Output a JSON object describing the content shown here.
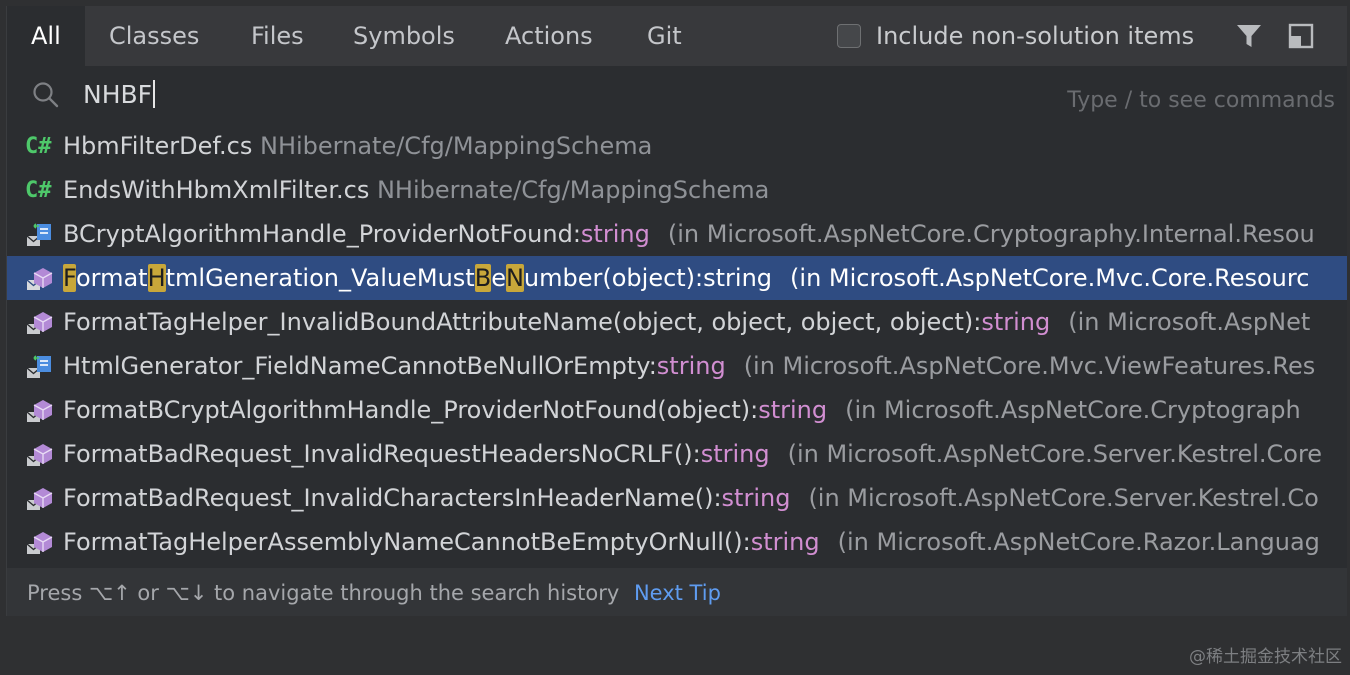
{
  "tabs": [
    "All",
    "Classes",
    "Files",
    "Symbols",
    "Actions",
    "Git"
  ],
  "toolbar": {
    "include_label": "Include non-solution items",
    "filter_icon": "filter-icon",
    "preview_icon": "preview-panel-icon"
  },
  "search": {
    "value": "NHBF",
    "hint": "Type / to see commands"
  },
  "results": [
    {
      "icon": "csharp-file-icon",
      "name": "HbmFilterDef.cs",
      "path": "NHibernate/Cfg/MappingSchema"
    },
    {
      "icon": "csharp-file-icon",
      "name": "EndsWithHbmXmlFilter.cs",
      "path": "NHibernate/Cfg/MappingSchema"
    },
    {
      "icon": "resource-property-icon",
      "name": "BCryptAlgorithmHandle_ProviderNotFound:",
      "type": "string",
      "location": "(in Microsoft.AspNetCore.Cryptography.Internal.Resou"
    },
    {
      "icon": "resource-method-icon",
      "name_parts": [
        "F",
        "ormat",
        "H",
        "tmlGeneration_ValueMust",
        "B",
        "e",
        "N",
        "umber(object):string"
      ],
      "location": "(in Microsoft.AspNetCore.Mvc.Core.Resourc",
      "selected": true
    },
    {
      "icon": "resource-method-icon",
      "name": "FormatTagHelper_InvalidBoundAttributeName(object, object, object, object):",
      "type": "string",
      "location": "(in Microsoft.AspNet"
    },
    {
      "icon": "resource-property-icon",
      "name": "HtmlGenerator_FieldNameCannotBeNullOrEmpty:",
      "type": "string",
      "location": "(in Microsoft.AspNetCore.Mvc.ViewFeatures.Res"
    },
    {
      "icon": "resource-method-icon",
      "name": "FormatBCryptAlgorithmHandle_ProviderNotFound(object):",
      "type": "string",
      "location": "(in Microsoft.AspNetCore.Cryptograph"
    },
    {
      "icon": "resource-method-icon",
      "name": "FormatBadRequest_InvalidRequestHeadersNoCRLF():",
      "type": "string",
      "location": "(in Microsoft.AspNetCore.Server.Kestrel.Core"
    },
    {
      "icon": "resource-method-icon",
      "name": "FormatBadRequest_InvalidCharactersInHeaderName():",
      "type": "string",
      "location": "(in Microsoft.AspNetCore.Server.Kestrel.Co"
    },
    {
      "icon": "resource-method-icon",
      "name": "FormatTagHelperAssemblyNameCannotBeEmptyOrNull():",
      "type": "string",
      "location": "(in Microsoft.AspNetCore.Razor.Languag"
    }
  ],
  "footer": {
    "text": "Press ⌥↑ or ⌥↓ to navigate through the search history",
    "next_tip": "Next Tip"
  },
  "watermark": "@稀土掘金技术社区",
  "colors": {
    "accent_selection": "#2f4c82",
    "match_highlight": "#c8a73a",
    "type_color": "#d18ed1",
    "link": "#5f9cf0",
    "csharp_icon": "#4ec86a"
  }
}
